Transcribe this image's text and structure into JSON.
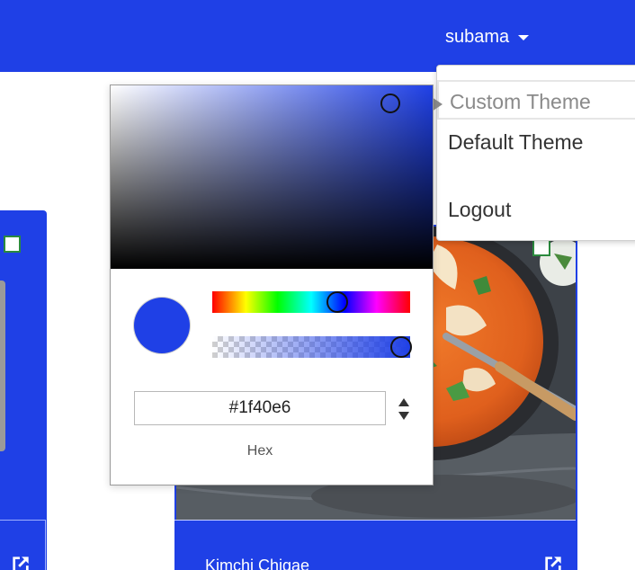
{
  "theme": {
    "accent": "#1f40e6"
  },
  "navbar": {
    "username": "subama"
  },
  "user_menu": {
    "items": [
      {
        "label": "Custom Theme",
        "active": true
      },
      {
        "label": "Default Theme",
        "active": false
      },
      {
        "label": "Logout",
        "active": false
      }
    ]
  },
  "color_picker": {
    "hex_value": "#1f40e6",
    "mode_label": "Hex",
    "current_color": "#1f40e6",
    "hue_level": 0.63,
    "alpha_level": 1.0,
    "saturation_level": 0.87,
    "brightness_level": 0.9
  },
  "cards": [
    {
      "title": "Kimchi Chigae"
    }
  ],
  "icons": {
    "external_link": "external-link-icon",
    "caret": "chevron-down-icon",
    "spinner": "up-down-arrows-icon"
  }
}
